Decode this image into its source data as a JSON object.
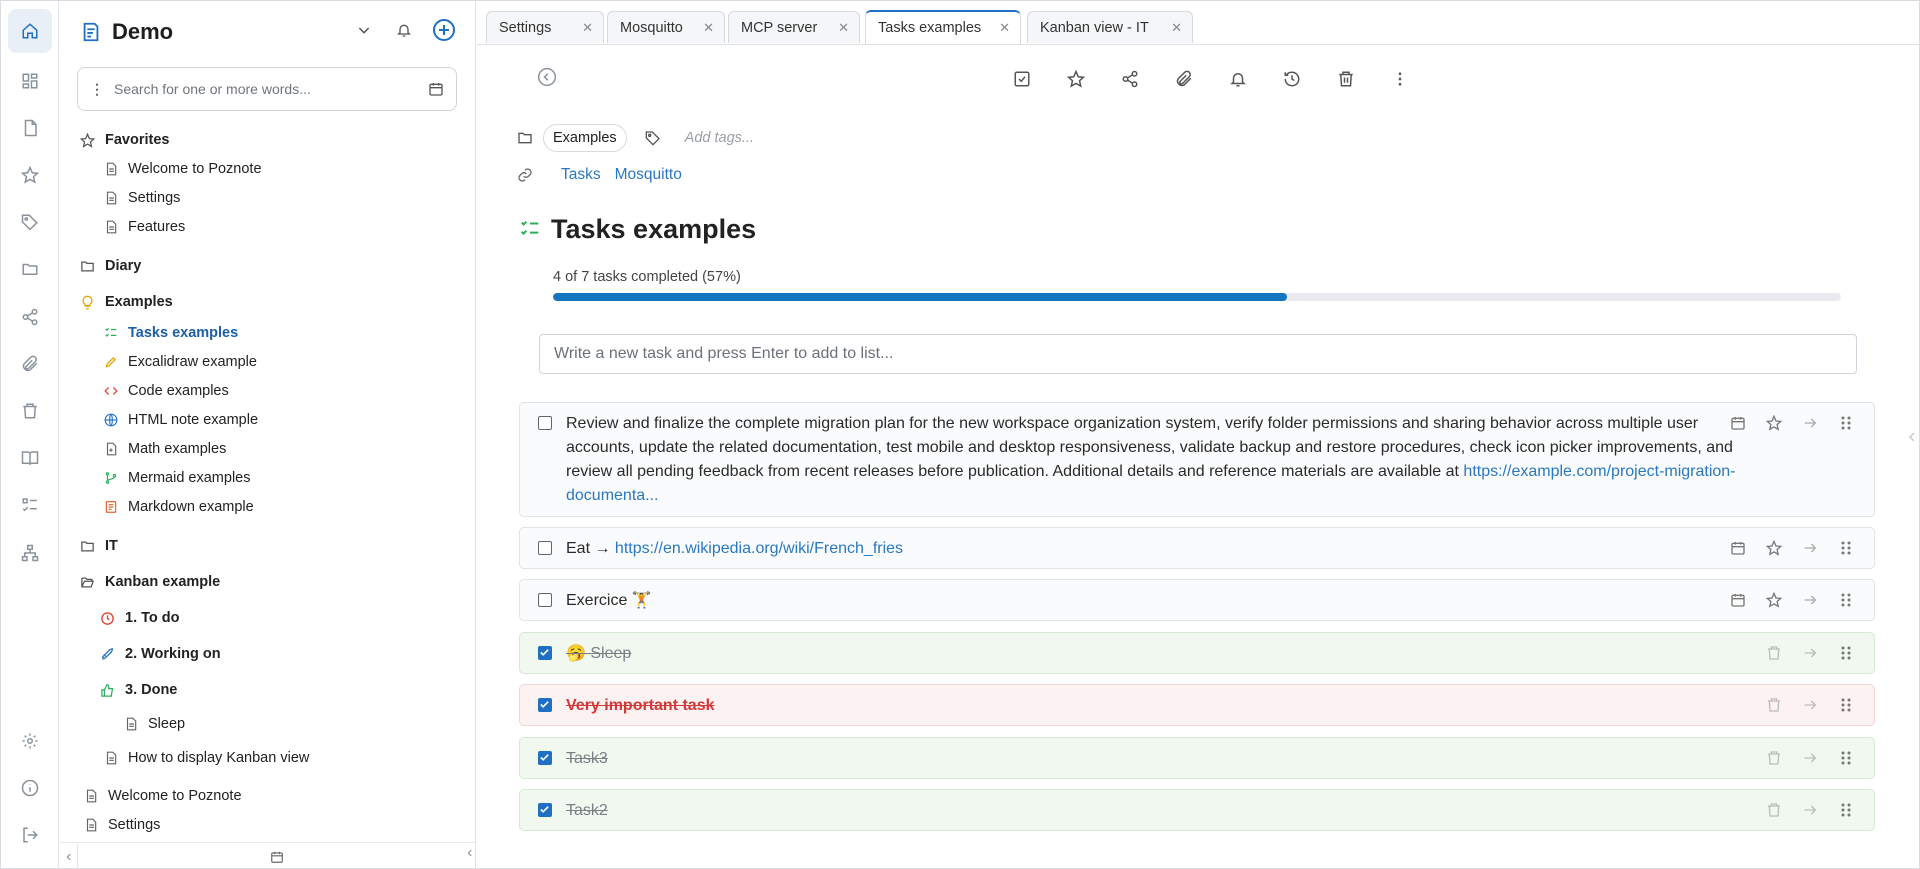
{
  "workspace": {
    "name": "Demo"
  },
  "search": {
    "placeholder": "Search for one or more words..."
  },
  "sidebar": {
    "favorites": {
      "label": "Favorites",
      "items": [
        "Welcome to Poznote",
        "Settings",
        "Features"
      ]
    },
    "diary": {
      "label": "Diary"
    },
    "examples": {
      "label": "Examples",
      "items": [
        "Tasks examples",
        "Excalidraw example",
        "Code examples",
        "HTML note example",
        "Math examples",
        "Mermaid examples",
        "Markdown example"
      ]
    },
    "it": {
      "label": "IT"
    },
    "kanban": {
      "label": "Kanban example",
      "columns": [
        "1. To do",
        "2. Working on",
        "3. Done"
      ],
      "done_items": [
        "Sleep"
      ],
      "items": [
        "How to display Kanban view"
      ]
    },
    "root_items": [
      "Welcome to Poznote",
      "Settings"
    ]
  },
  "tabs": [
    {
      "label": "Settings",
      "active": false
    },
    {
      "label": "Mosquitto",
      "active": false
    },
    {
      "label": "MCP server",
      "active": false
    },
    {
      "label": "Tasks examples",
      "active": true
    },
    {
      "label": "Kanban view - IT",
      "active": false
    }
  ],
  "note": {
    "folder": "Examples",
    "tags_placeholder": "Add tags...",
    "links": [
      "Tasks",
      "Mosquitto"
    ],
    "title": "Tasks examples",
    "progress": {
      "label": "4 of 7 tasks completed (57%)",
      "completed": 4,
      "total": 7,
      "fraction": 0.57
    },
    "new_task_placeholder": "Write a new task and press Enter to add to list...",
    "tasks": [
      {
        "text": "Review and finalize the complete migration plan for the new workspace organization system, verify folder permissions and sharing behavior across multiple user accounts, update the related documentation, test mobile and desktop responsiveness, validate backup and restore procedures, check icon picker improvements, and review all pending feedback from recent releases before publication. Additional details and reference materials are available at",
        "link": "https://example.com/project-migration-documenta...",
        "done": false
      },
      {
        "text": "Eat →",
        "link": "https://en.wikipedia.org/wiki/French_fries",
        "done": false
      },
      {
        "text": "Exercice 🏋️",
        "link": "",
        "done": false
      },
      {
        "text": "🥱 Sleep",
        "link": "",
        "done": true
      },
      {
        "text": "Very important task",
        "link": "",
        "done": true,
        "important": true
      },
      {
        "text": "Task3",
        "link": "",
        "done": true
      },
      {
        "text": "Task2",
        "link": "",
        "done": true
      }
    ]
  },
  "colors": {
    "accent": "#1f6fc5",
    "progress": "#1476c0",
    "link": "#2a78c0",
    "done_bg": "#f1f8ef",
    "important_bg": "#fdf2f2"
  }
}
